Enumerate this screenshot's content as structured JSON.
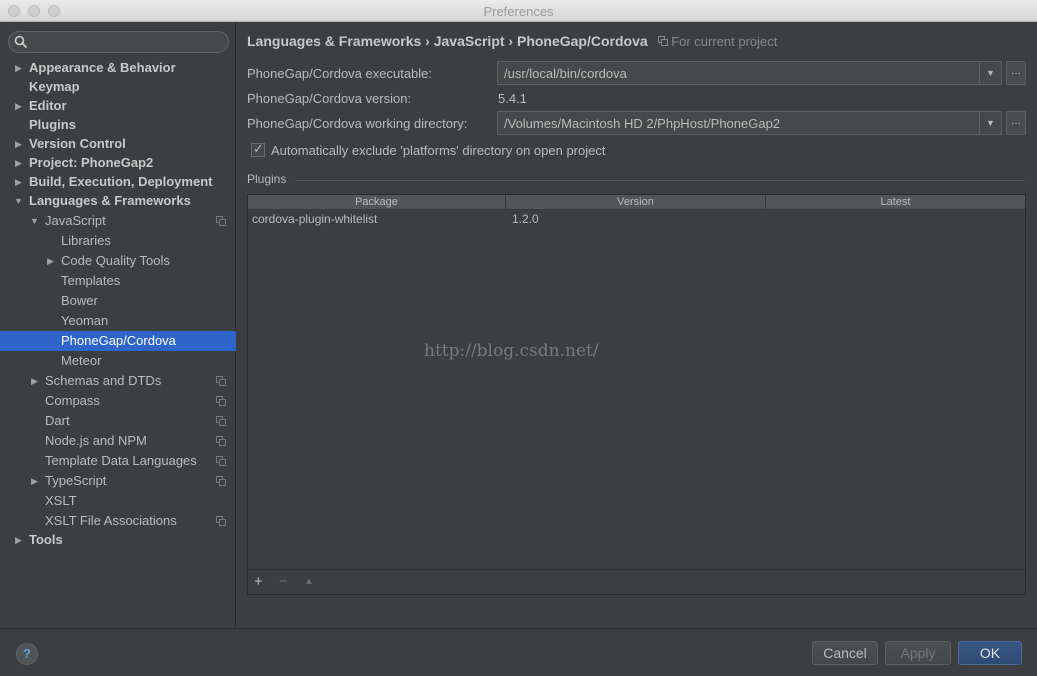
{
  "window": {
    "title": "Preferences"
  },
  "search": {
    "placeholder": ""
  },
  "sidebar": {
    "items": [
      {
        "label": "Appearance & Behavior",
        "arrow": "▶"
      },
      {
        "label": "Keymap",
        "arrow": ""
      },
      {
        "label": "Editor",
        "arrow": "▶"
      },
      {
        "label": "Plugins",
        "arrow": ""
      },
      {
        "label": "Version Control",
        "arrow": "▶"
      },
      {
        "label": "Project: PhoneGap2",
        "arrow": "▶"
      },
      {
        "label": "Build, Execution, Deployment",
        "arrow": "▶"
      },
      {
        "label": "Languages & Frameworks",
        "arrow": "▼"
      },
      {
        "label": "JavaScript",
        "arrow": "▼"
      },
      {
        "label": "Libraries",
        "arrow": ""
      },
      {
        "label": "Code Quality Tools",
        "arrow": "▶"
      },
      {
        "label": "Templates",
        "arrow": ""
      },
      {
        "label": "Bower",
        "arrow": ""
      },
      {
        "label": "Yeoman",
        "arrow": ""
      },
      {
        "label": "PhoneGap/Cordova",
        "arrow": ""
      },
      {
        "label": "Meteor",
        "arrow": ""
      },
      {
        "label": "Schemas and DTDs",
        "arrow": "▶"
      },
      {
        "label": "Compass",
        "arrow": ""
      },
      {
        "label": "Dart",
        "arrow": ""
      },
      {
        "label": "Node.js and NPM",
        "arrow": ""
      },
      {
        "label": "Template Data Languages",
        "arrow": ""
      },
      {
        "label": "TypeScript",
        "arrow": "▶"
      },
      {
        "label": "XSLT",
        "arrow": ""
      },
      {
        "label": "XSLT File Associations",
        "arrow": ""
      },
      {
        "label": "Tools",
        "arrow": "▶"
      }
    ]
  },
  "breadcrumb": {
    "path": "Languages & Frameworks › JavaScript › PhoneGap/Cordova",
    "project_note": "For current project"
  },
  "form": {
    "executable_label": "PhoneGap/Cordova executable:",
    "executable_value": "/usr/local/bin/cordova",
    "version_label": "PhoneGap/Cordova version:",
    "version_value": "5.4.1",
    "workdir_label": "PhoneGap/Cordova working directory:",
    "workdir_value": "/Volumes/Macintosh HD 2/PhpHost/PhoneGap2",
    "browse_label": "...",
    "exclude_label": "Automatically exclude 'platforms' directory on open project",
    "exclude_checked": true
  },
  "plugins": {
    "section_label": "Plugins",
    "columns": [
      "Package",
      "Version",
      "Latest"
    ],
    "rows": [
      {
        "package": "cordova-plugin-whitelist",
        "version": "1.2.0",
        "latest": ""
      }
    ],
    "watermark": "http://blog.csdn.net/",
    "tools": {
      "add": "+",
      "remove": "−",
      "upgrade": "▲"
    }
  },
  "buttons": {
    "help": "?",
    "cancel": "Cancel",
    "apply": "Apply",
    "ok": "OK"
  },
  "colors": {
    "selection": "#2f65ca",
    "ok_button": "#2d4b73",
    "background": "#3c3f41"
  }
}
